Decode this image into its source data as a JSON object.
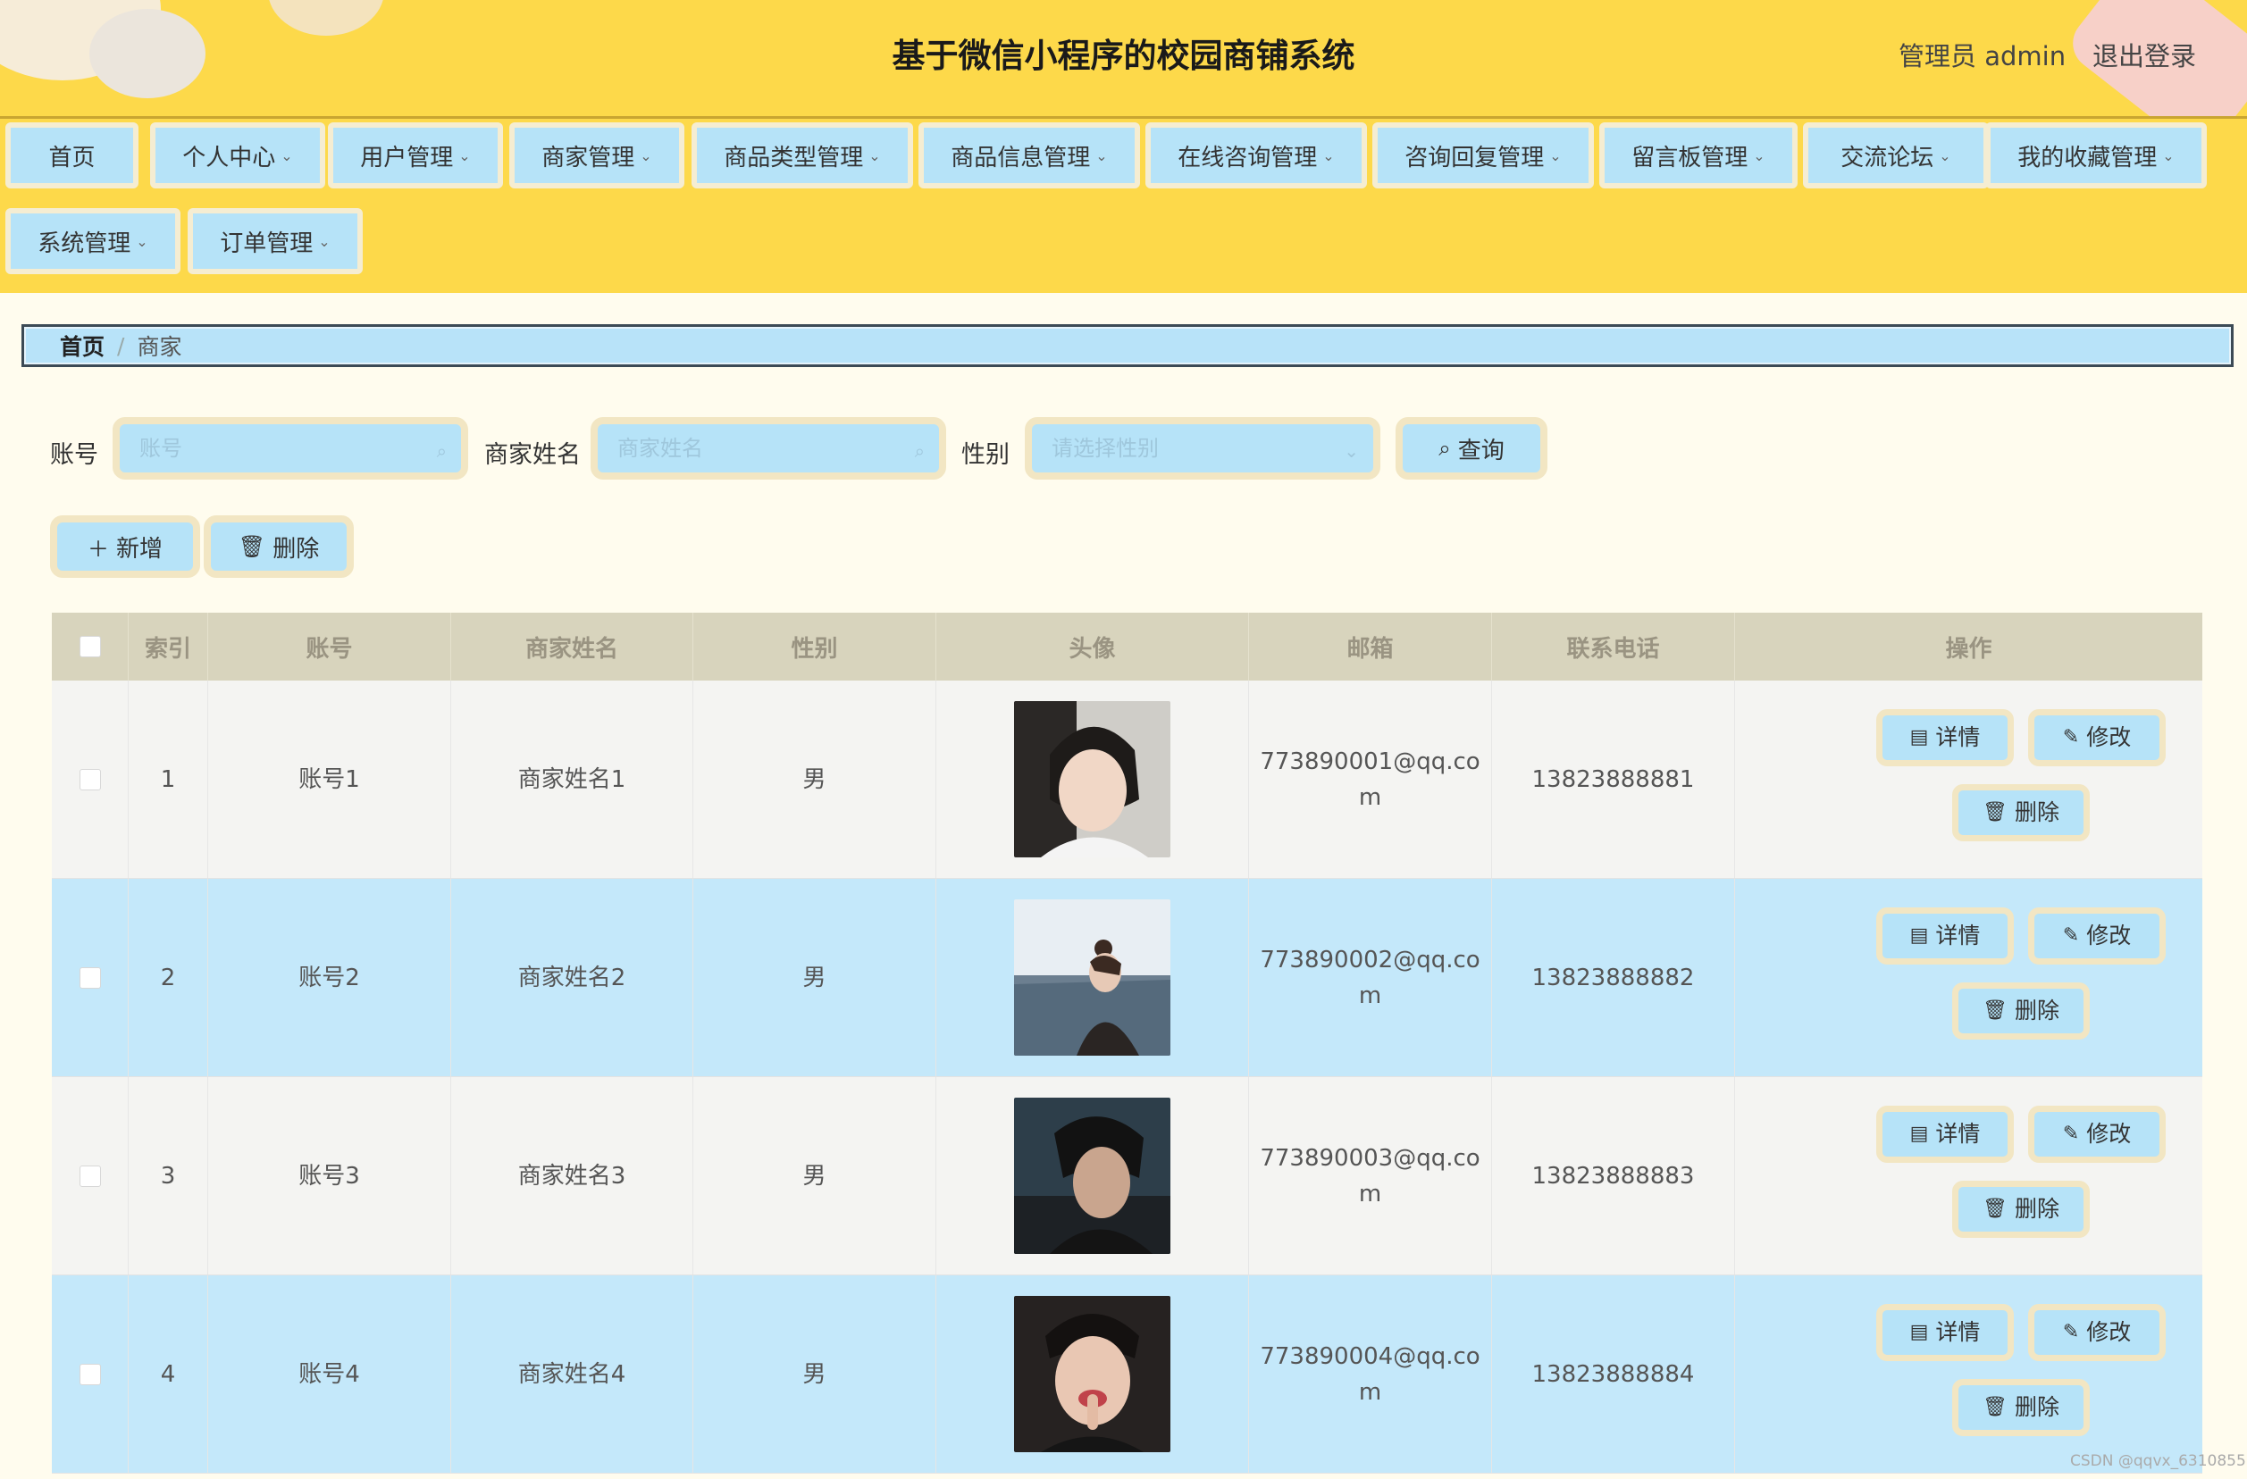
{
  "header": {
    "title": "基于微信小程序的校园商铺系统",
    "user": "管理员 admin",
    "logout": "退出登录"
  },
  "nav": [
    {
      "label": "首页",
      "has_dropdown": false
    },
    {
      "label": "个人中心",
      "has_dropdown": true
    },
    {
      "label": "用户管理",
      "has_dropdown": true
    },
    {
      "label": "商家管理",
      "has_dropdown": true
    },
    {
      "label": "商品类型管理",
      "has_dropdown": true
    },
    {
      "label": "商品信息管理",
      "has_dropdown": true
    },
    {
      "label": "在线咨询管理",
      "has_dropdown": true
    },
    {
      "label": "咨询回复管理",
      "has_dropdown": true
    },
    {
      "label": "留言板管理",
      "has_dropdown": true
    },
    {
      "label": "交流论坛",
      "has_dropdown": true
    },
    {
      "label": "我的收藏管理",
      "has_dropdown": true
    },
    {
      "label": "系统管理",
      "has_dropdown": true
    },
    {
      "label": "订单管理",
      "has_dropdown": true
    }
  ],
  "breadcrumb": {
    "home": "首页",
    "separator": "/",
    "current": "商家"
  },
  "search": {
    "account_label": "账号",
    "account_placeholder": "账号",
    "name_label": "商家姓名",
    "name_placeholder": "商家姓名",
    "gender_label": "性别",
    "gender_placeholder": "请选择性别",
    "query_button": "查询"
  },
  "actions": {
    "add": "新增",
    "delete": "删除"
  },
  "table": {
    "headers": [
      "索引",
      "账号",
      "商家姓名",
      "性别",
      "头像",
      "邮箱",
      "联系电话",
      "操作"
    ],
    "rows": [
      {
        "index": "1",
        "account": "账号1",
        "name": "商家姓名1",
        "gender": "男",
        "email_line1": "773890001@qq.co",
        "email_line2": "m",
        "phone": "13823888881"
      },
      {
        "index": "2",
        "account": "账号2",
        "name": "商家姓名2",
        "gender": "男",
        "email_line1": "773890002@qq.co",
        "email_line2": "m",
        "phone": "13823888882"
      },
      {
        "index": "3",
        "account": "账号3",
        "name": "商家姓名3",
        "gender": "男",
        "email_line1": "773890003@qq.co",
        "email_line2": "m",
        "phone": "13823888883"
      },
      {
        "index": "4",
        "account": "账号4",
        "name": "商家姓名4",
        "gender": "男",
        "email_line1": "773890004@qq.co",
        "email_line2": "m",
        "phone": "13823888884"
      }
    ],
    "row_buttons": {
      "detail": "详情",
      "edit": "修改",
      "delete": "删除"
    }
  },
  "watermark": "CSDN @qqvx_6310855",
  "colors": {
    "header_bg": "#fdd94a",
    "button_bg": "#b6e3f8",
    "button_border": "#f2e6c3",
    "page_bg": "#fffcee"
  }
}
